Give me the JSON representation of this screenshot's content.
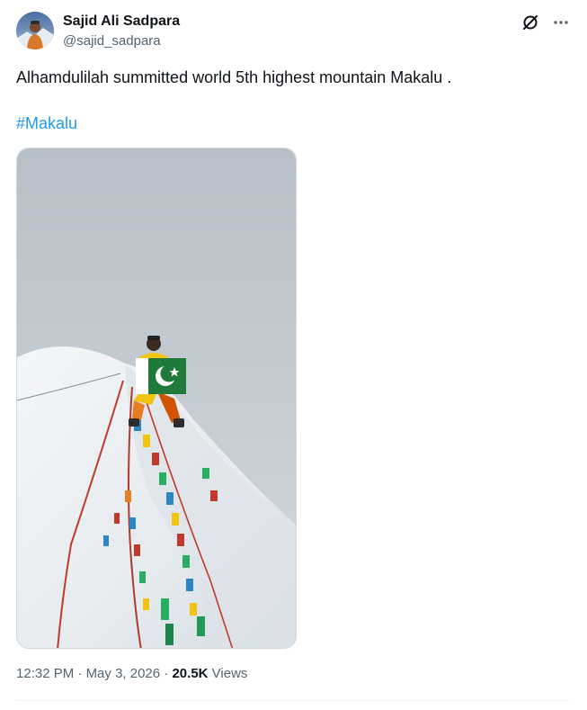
{
  "author": {
    "display_name": "Sajid Ali Sadpara",
    "handle": "@sajid_sadpara",
    "avatar_icon": "avatar-photo"
  },
  "tweet": {
    "text": "Alhamdulilah summitted world 5th highest mountain Makalu .",
    "hashtag": "#Makalu"
  },
  "media": {
    "type": "photo"
  },
  "meta": {
    "time": "12:32 PM",
    "separator": "·",
    "date": "May 3, 2026",
    "views_count": "20.5K",
    "views_label": "Views"
  },
  "icons": {
    "grok": "grok-icon",
    "more": "more-icon"
  },
  "colors": {
    "link": "#1d9bf0",
    "secondary_text": "#536471",
    "primary_text": "#0f1419"
  }
}
